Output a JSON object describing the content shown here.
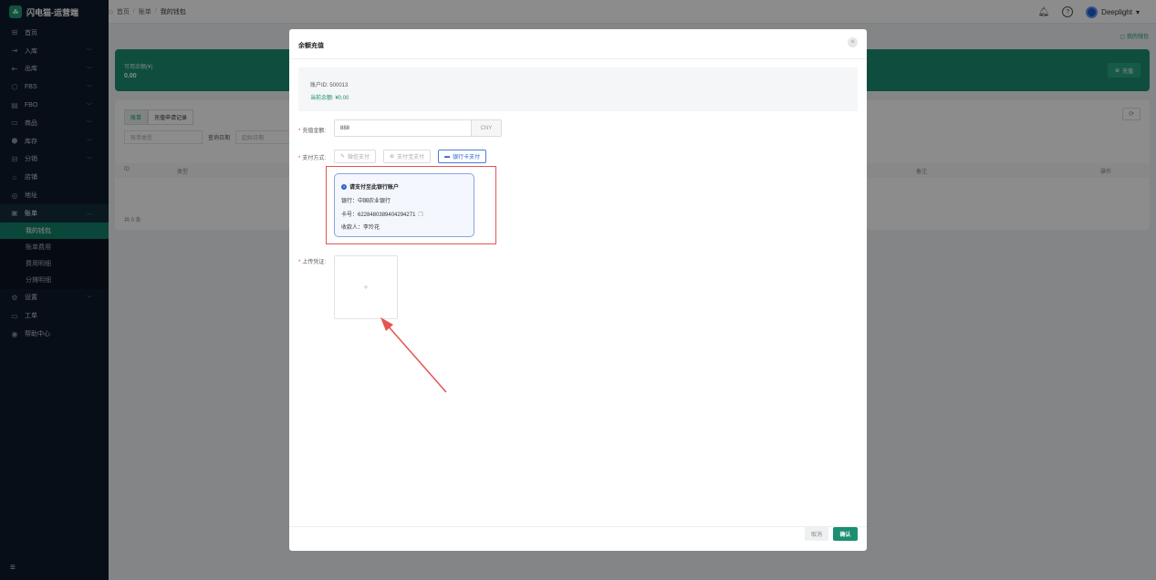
{
  "app": {
    "title": "闪电猫-运营端"
  },
  "sidebar": {
    "items": [
      {
        "label": "首页",
        "icon": "grid-icon",
        "chevron": false
      },
      {
        "label": "入库",
        "icon": "login-icon",
        "chevron": true
      },
      {
        "label": "出库",
        "icon": "logout-icon",
        "chevron": true
      },
      {
        "label": "FBS",
        "icon": "box-icon",
        "chevron": true
      },
      {
        "label": "FBO",
        "icon": "warehouse-icon",
        "chevron": true
      },
      {
        "label": "商品",
        "icon": "product-icon",
        "chevron": true
      },
      {
        "label": "库存",
        "icon": "cube-icon",
        "chevron": true
      },
      {
        "label": "分销",
        "icon": "distribution-icon",
        "chevron": true
      },
      {
        "label": "店铺",
        "icon": "store-icon",
        "chevron": false
      },
      {
        "label": "地址",
        "icon": "location-icon",
        "chevron": false
      },
      {
        "label": "账单",
        "icon": "bill-icon",
        "chevron": true
      }
    ],
    "sub_items": [
      "我的钱包",
      "账单费用",
      "费用明细",
      "分摊明细"
    ],
    "items_after": [
      {
        "label": "设置",
        "icon": "gear-icon",
        "chevron": true
      },
      {
        "label": "工单",
        "icon": "ticket-icon",
        "chevron": false
      },
      {
        "label": "帮助中心",
        "icon": "help-icon",
        "chevron": false
      }
    ]
  },
  "header": {
    "breadcrumb": [
      "首页",
      "账单",
      "我的钱包"
    ],
    "user_name": "Deeplight"
  },
  "page": {
    "link": "我的钱包",
    "wallet_label": "可用余额(¥)",
    "wallet_value": "0.00",
    "recharge_label": "充值",
    "tabs": [
      "账单",
      "充值申请记录"
    ],
    "filter_type_placeholder": "账单类型",
    "filter_date_label": "查询日期",
    "filter_date_placeholder": "起始日期",
    "columns": [
      "ID",
      "类型",
      "备注",
      "操作"
    ],
    "total": "共 0 条"
  },
  "modal": {
    "title": "余额充值",
    "account_id": "账户ID: 500013",
    "current_balance": "当前余额: ¥0.00",
    "amount_label": "充值金额:",
    "amount_value": "888",
    "amount_unit": "CNY",
    "pay_label": "支付方式:",
    "pay_options": [
      "微信支付",
      "支付宝支付",
      "银行卡支付"
    ],
    "bank": {
      "title": "请支付至此银行账户",
      "bank_line": "银行：中国农业银行",
      "card_line": "卡号：6228480389404294271",
      "payee_line": "收款人：李玲花"
    },
    "upload_label": "上传凭证:",
    "cancel": "取消",
    "confirm": "确认"
  }
}
